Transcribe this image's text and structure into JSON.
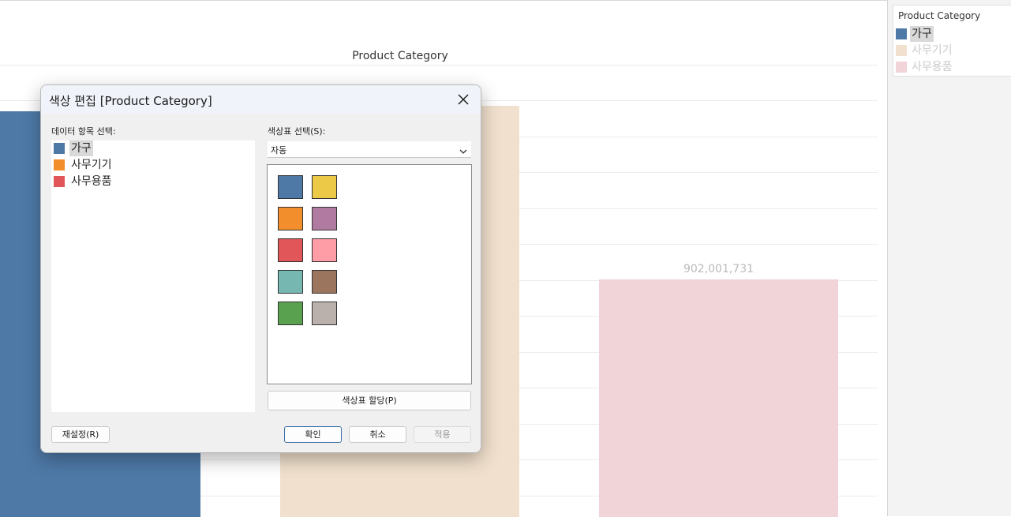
{
  "chart": {
    "title": "Product Category",
    "value_label": "902,001,731",
    "colors": {
      "furniture": "#4e79a7",
      "office_equipment": "#f1e0cd",
      "office_supplies": "#f0d4d7"
    }
  },
  "legend": {
    "title": "Product Category",
    "items": [
      {
        "label": "가구",
        "color": "#4e79a7"
      },
      {
        "label": "사무기기",
        "color": "#f1e0cd"
      },
      {
        "label": "사무용품",
        "color": "#f0d4d7"
      }
    ]
  },
  "dialog": {
    "title": "색상 편집 [Product Category]",
    "close_icon": "close-icon",
    "data_items_label": "데이터 항목 선택:",
    "data_items": [
      {
        "label": "가구",
        "color": "#4e79a7"
      },
      {
        "label": "사무기기",
        "color": "#f28e2b"
      },
      {
        "label": "사무용품",
        "color": "#e15759"
      }
    ],
    "palette_label": "색상표 선택(S):",
    "palette_value": "자동",
    "swatches": [
      "#4e79a7",
      "#edc948",
      "#f28e2b",
      "#b07aa1",
      "#e15759",
      "#ff9da7",
      "#76b7b2",
      "#9c755f",
      "#59a14f",
      "#bab0ac"
    ],
    "assign_button": "색상표 할당(P)",
    "reset_button": "재설정(R)",
    "ok_button": "확인",
    "cancel_button": "취소",
    "apply_button": "적용"
  }
}
